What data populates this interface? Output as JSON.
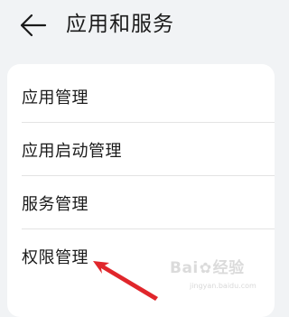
{
  "header": {
    "title": "应用和服务"
  },
  "menu": {
    "items": [
      {
        "label": "应用管理"
      },
      {
        "label": "应用启动管理"
      },
      {
        "label": "服务管理"
      },
      {
        "label": "权限管理"
      }
    ]
  },
  "icons": {
    "back": "arrow-left-icon"
  },
  "colors": {
    "background": "#f1f3f5",
    "card": "#ffffff",
    "text": "#1a1a1a",
    "annotation_arrow": "#e0262b"
  },
  "watermark": {
    "brand_left": "Bai",
    "brand_right": "经验",
    "sub": "jingyan.baidu.com"
  }
}
